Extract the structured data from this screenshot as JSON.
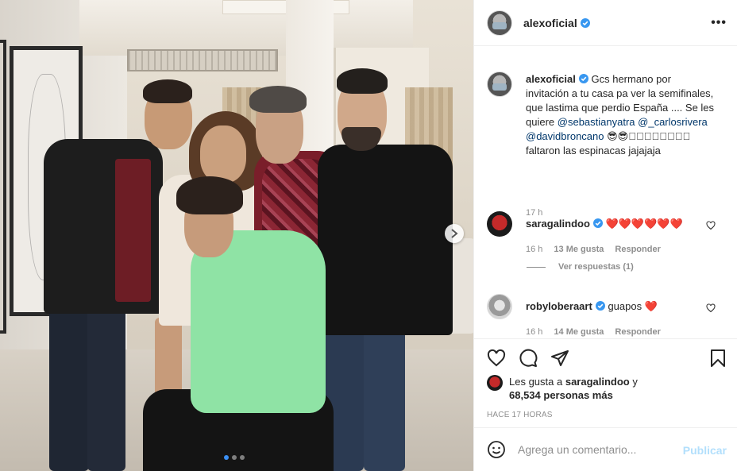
{
  "post": {
    "username": "alexoficial",
    "more_label": "•••"
  },
  "caption": {
    "username": "alexoficial",
    "text_1": "Gcs hermano por invitación a tu casa pa ver la semifinales, que lastima que perdio España .... Se les quiere",
    "mention_1": "@sebastianyatra",
    "mention_2": "@_carlosrivera",
    "mention_3": "@davidbroncano",
    "text_2": "😎😎􀀀􀀀􀀀􀀀􀀀􀀀􀀀􀀀 faltaron las espinacas jajajaja",
    "time": "17 h"
  },
  "comments": [
    {
      "username": "saragalindoo",
      "text": "❤️❤️❤️❤️❤️❤️",
      "time": "16 h",
      "likes": "13 Me gusta",
      "reply": "Responder"
    },
    {
      "username": "robyloberaart",
      "text": "guapos ❤️",
      "time": "16 h",
      "likes": "14 Me gusta",
      "reply": "Responder"
    }
  ],
  "view_replies": "Ver respuestas (1)",
  "likes": {
    "prefix": "Les gusta a",
    "user": "saragalindoo",
    "connector": "y",
    "count": "68,534 personas más"
  },
  "timestamp": "HACE 17 HORAS",
  "add_comment": {
    "placeholder": "Agrega un comentario...",
    "publish": "Publicar"
  },
  "colors": {
    "verified": "#3897f0",
    "link": "#00376b",
    "muted": "#8e8e8e",
    "publish_disabled": "#b2dffc",
    "heart": "#c81e2a"
  },
  "icons": [
    "more-options-icon",
    "verified-icon",
    "heart-icon",
    "comment-icon",
    "share-icon",
    "bookmark-icon",
    "emoji-icon",
    "next-arrow-icon"
  ],
  "carousel": {
    "slides": 3,
    "active": 1
  }
}
